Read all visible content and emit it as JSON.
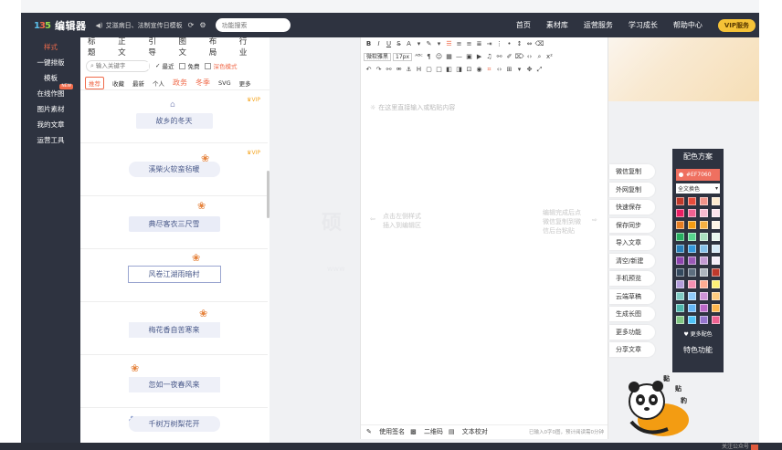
{
  "header": {
    "logo_text": "编辑器",
    "announcement": "艾滋病日、法制宣传日模板",
    "search_placeholder": "功能搜索",
    "nav": [
      "首页",
      "素材库",
      "运营服务",
      "学习成长",
      "帮助中心"
    ],
    "vip_label": "VIP服务"
  },
  "leftnav": {
    "items": [
      {
        "label": "样式",
        "active": true
      },
      {
        "label": "一键排版"
      },
      {
        "label": "模板"
      },
      {
        "label": "在线作图",
        "badge": "NEW"
      },
      {
        "label": "图片素材"
      },
      {
        "label": "我的文章"
      },
      {
        "label": "运营工具"
      }
    ]
  },
  "panel": {
    "categories": [
      "标题",
      "正文",
      "引导",
      "图文",
      "布局",
      "行业"
    ],
    "keyword_placeholder": "输入关键字",
    "recent_label": "最近",
    "free_label": "免费",
    "dark_label": "深色模式",
    "subtabs": [
      "推荐",
      "收藏",
      "最新",
      "个人",
      "政务",
      "冬季",
      "SVG",
      "更多"
    ],
    "vip_badge": "VIP",
    "cards": [
      "故乡的冬天",
      "溪柴火软蛮毡暖",
      "典尽客衣三尺雪",
      "风卷江湖雨暗村",
      "梅花香自苦寒来",
      "忽如一夜春风来",
      "千树万树梨花开"
    ]
  },
  "editor": {
    "placeholder": "在这里直接输入或粘贴内容",
    "hint_left_1": "点击左侧样式",
    "hint_left_2": "插入到编辑区",
    "hint_right_1": "编辑完成后点",
    "hint_right_2": "微信复制到微",
    "hint_right_3": "信后台粘贴",
    "font_select": "微软雅黑",
    "size_select": "17px",
    "footer": {
      "signature": "使用签名",
      "qrcode": "二维码",
      "proofread": "文本校对",
      "count": "已输入0字0图，预计阅读需0分钟"
    }
  },
  "actions": [
    "微信复制",
    "外网复制",
    "快速保存",
    "保存同步",
    "导入文章",
    "清空/新建",
    "手机预览",
    "云端草稿",
    "生成长图",
    "更多功能",
    "分享文章"
  ],
  "color_panel": {
    "title": "配色方案",
    "current": "#EF7060",
    "select_value": "全文换色",
    "more_label": "更多配色",
    "feature_label": "特色功能",
    "swatches": [
      "#c0392b",
      "#e74c3c",
      "#f1948a",
      "#fdebd0",
      "#e91e63",
      "#f06292",
      "#f8bbd0",
      "#fce4ec",
      "#e67e22",
      "#f39c12",
      "#f5b041",
      "#fef5e7",
      "#27ae60",
      "#58d68d",
      "#a9dfbf",
      "#e9f7ef",
      "#2980b9",
      "#3498db",
      "#85c1e9",
      "#d6eaf8",
      "#8e44ad",
      "#9b59b6",
      "#c39bd3",
      "#f5eef8",
      "#34495e",
      "#5d6d7e",
      "#aeb6bf",
      "#c0392b",
      "#b39ddb",
      "#f48fb1",
      "#ffab91",
      "#fff176",
      "#80cbc4",
      "#90caf9",
      "#ce93d8",
      "#ffcc80",
      "#4db6ac",
      "#64b5f6",
      "#ba68c8",
      "#ffb74d",
      "#81c784",
      "#4fc3f7",
      "#9575cd",
      "#f06292"
    ]
  },
  "mascot_text": [
    "黏",
    "贴",
    "豹"
  ],
  "footer_text": "关注公众号"
}
